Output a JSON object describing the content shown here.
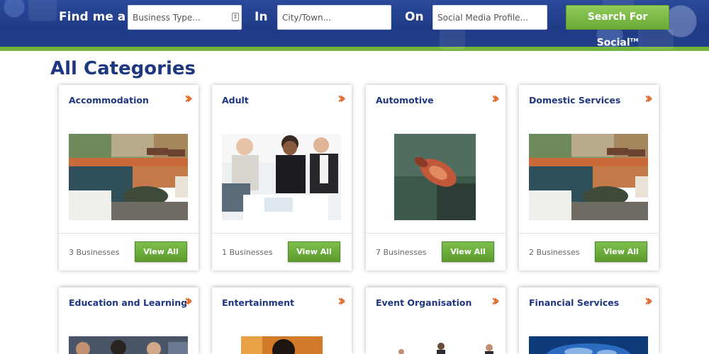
{
  "search": {
    "find_label": "Find me a",
    "business_placeholder": "Business Type...",
    "in_label": "In",
    "city_placeholder": "City/Town...",
    "on_label": "On",
    "social_placeholder": "Social Media Profile...",
    "button_label": "Search For Social",
    "button_tm": "TM"
  },
  "page_title": "All Categories",
  "colors": {
    "header_blue": "#1f3b86",
    "accent_green": "#73b53d",
    "title_blue": "#1f3680",
    "chevron_orange": "#e06a2a"
  },
  "categories": [
    {
      "name": "Accommodation",
      "count": "3 Businesses",
      "button": "View All",
      "image": "pool-terrace-photo"
    },
    {
      "name": "Adult",
      "count": "1 Businesses",
      "button": "View All",
      "image": "business-meeting-photo"
    },
    {
      "name": "Automotive",
      "count": "7 Businesses",
      "button": "View All",
      "image": "spark-plug-photo"
    },
    {
      "name": "Domestic Services",
      "count": "2 Businesses",
      "button": "View All",
      "image": "pool-terrace-photo"
    },
    {
      "name": "Education and Learning",
      "image": "classroom-photo"
    },
    {
      "name": "Entertainment",
      "image": "performer-photo"
    },
    {
      "name": "Event Organisation",
      "image": "people-group-photo"
    },
    {
      "name": "Financial Services",
      "image": "globe-network-photo"
    }
  ],
  "icons": {
    "card_arrow": "double-chevron-right-icon"
  }
}
